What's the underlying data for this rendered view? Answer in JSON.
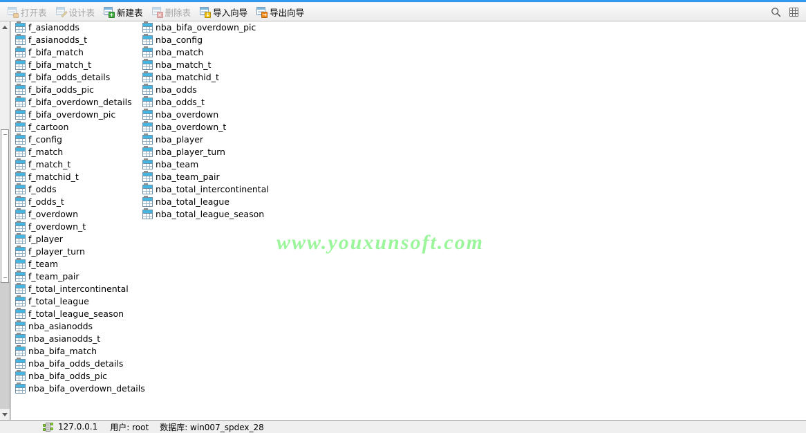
{
  "window": {
    "accent_color": "#3399ee",
    "watermark": "www.youxunsoft.com",
    "watermark_color": "#9bf59b"
  },
  "toolbar": {
    "items": [
      {
        "label": "打开表",
        "icon": "open-table-icon",
        "enabled": false
      },
      {
        "label": "设计表",
        "icon": "design-table-icon",
        "enabled": false
      },
      {
        "label": "新建表",
        "icon": "new-table-icon",
        "enabled": true
      },
      {
        "label": "删除表",
        "icon": "delete-table-icon",
        "enabled": false
      },
      {
        "label": "导入向导",
        "icon": "import-wizard-icon",
        "enabled": true
      },
      {
        "label": "导出向导",
        "icon": "export-wizard-icon",
        "enabled": true
      }
    ],
    "search_icon": "search-icon",
    "view_icon": "grid-view-icon"
  },
  "tables": {
    "column1": [
      "f_asianodds",
      "f_asianodds_t",
      "f_bifa_match",
      "f_bifa_match_t",
      "f_bifa_odds_details",
      "f_bifa_odds_pic",
      "f_bifa_overdown_details",
      "f_bifa_overdown_pic",
      "f_cartoon",
      "f_config",
      "f_match",
      "f_match_t",
      "f_matchid_t",
      "f_odds",
      "f_odds_t",
      "f_overdown",
      "f_overdown_t",
      "f_player",
      "f_player_turn",
      "f_team",
      "f_team_pair",
      "f_total_intercontinental",
      "f_total_league",
      "f_total_league_season",
      "nba_asianodds",
      "nba_asianodds_t",
      "nba_bifa_match",
      "nba_bifa_odds_details",
      "nba_bifa_odds_pic",
      "nba_bifa_overdown_details"
    ],
    "column2": [
      "nba_bifa_overdown_pic",
      "nba_config",
      "nba_match",
      "nba_match_t",
      "nba_matchid_t",
      "nba_odds",
      "nba_odds_t",
      "nba_overdown",
      "nba_overdown_t",
      "nba_player",
      "nba_player_turn",
      "nba_team",
      "nba_team_pair",
      "nba_total_intercontinental",
      "nba_total_league",
      "nba_total_league_season"
    ]
  },
  "statusbar": {
    "host": "127.0.0.1",
    "user": "用户: root",
    "database": "数据库: win007_spdex_28"
  }
}
